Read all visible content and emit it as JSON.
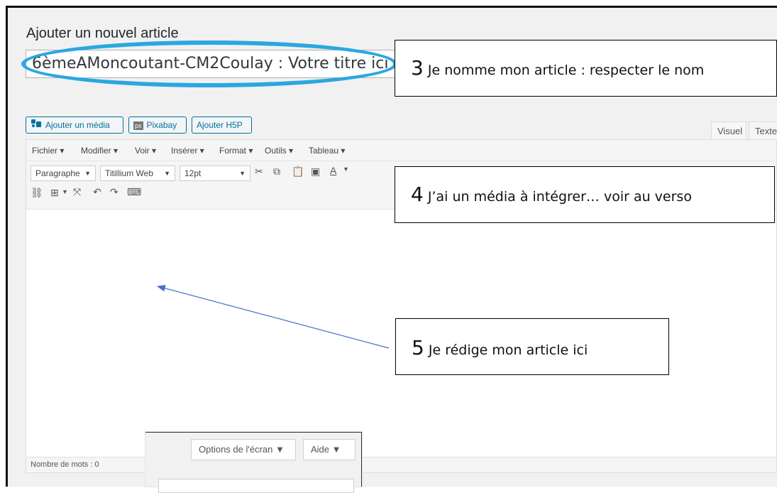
{
  "page": {
    "title": "Ajouter un nouvel article",
    "post_title_value": "6èmeAMoncoutant-CM2Coulay : Votre titre ici"
  },
  "media_buttons": [
    {
      "label": "Ajouter un média",
      "icon": "media-icon"
    },
    {
      "label": "Pixabay",
      "icon": "pixabay-icon",
      "icon_text": "px"
    },
    {
      "label": "Ajouter H5P"
    }
  ],
  "editor_tabs": [
    "Visuel",
    "Texte"
  ],
  "menubar": [
    "Fichier ▾",
    "Modifier ▾",
    "Voir ▾",
    "Insérer ▾",
    "Format ▾",
    "Outils ▾",
    "Tableau ▾"
  ],
  "toolbar": {
    "block_format": "Paragraphe",
    "font_family": "Titillium Web",
    "font_size": "12pt"
  },
  "status": {
    "word_count": "Nombre de mots : 0"
  },
  "screen_options": {
    "options_label": "Options de l'écran ▼",
    "help_label": "Aide ▼"
  },
  "annotations": [
    {
      "num": "3",
      "text": " Je nomme mon article : respecter le nom"
    },
    {
      "num": "4",
      "text": " J’ai un média à intégrer… voir au verso"
    },
    {
      "num": "5",
      "text": " Je rédige mon article ici"
    }
  ],
  "colors": {
    "highlight_ellipse": "#2aa7e0",
    "button_blue": "#0071a1",
    "arrow": "#4472c4"
  }
}
